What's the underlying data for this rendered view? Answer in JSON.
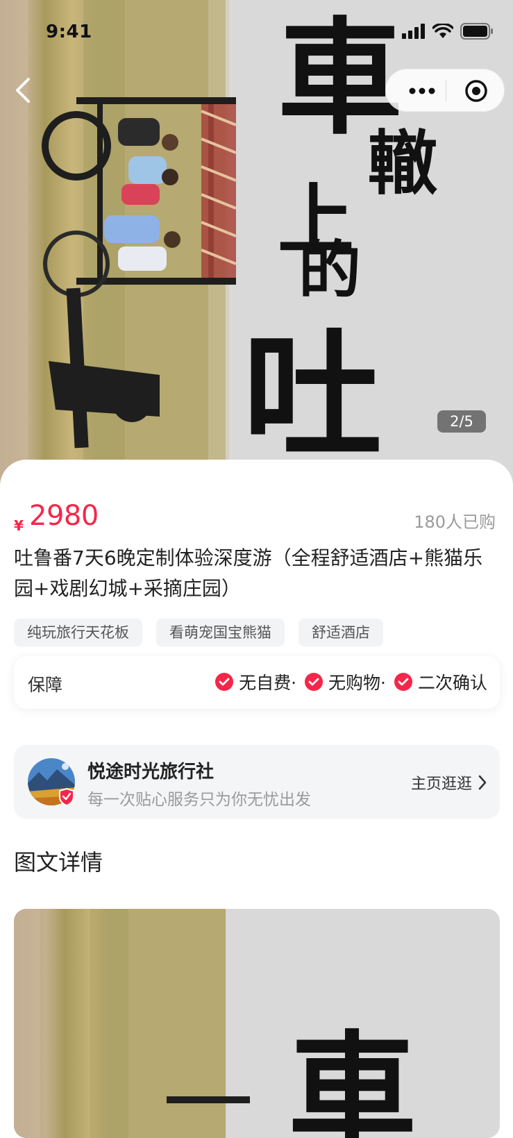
{
  "status_bar": {
    "time": "9:41"
  },
  "gallery": {
    "indicator": "2/5",
    "current": 2,
    "total": 5
  },
  "poster": {
    "text1": "車",
    "text2": "轍",
    "text3": "上",
    "text4": "的",
    "text5": "吐"
  },
  "product": {
    "currency": "¥",
    "price": "2980",
    "sold": "180人已购",
    "title": "吐鲁番7天6晚定制体验深度游（全程舒适酒店+熊猫乐园+戏剧幻城+采摘庄园）",
    "tags": [
      "纯玩旅行天花板",
      "看萌宠国宝熊猫",
      "舒适酒店"
    ]
  },
  "guarantee": {
    "label": "保障",
    "items": [
      "无自费·",
      "无购物·",
      "二次确认"
    ]
  },
  "agency": {
    "name": "悦途时光旅行社",
    "slogan": "每一次贴心服务只为你无忧出发",
    "link": "主页逛逛"
  },
  "detail": {
    "title": "图文详情"
  },
  "colors": {
    "accent": "#f5264a",
    "tag_bg": "#f2f3f5",
    "card_bg": "#f4f5f7"
  },
  "icons": [
    "back-arrow-icon",
    "more-dots-icon",
    "target-close-icon",
    "signal-icon",
    "wifi-icon",
    "battery-icon",
    "check-circle-icon",
    "verified-shield-icon",
    "chevron-right-icon"
  ]
}
